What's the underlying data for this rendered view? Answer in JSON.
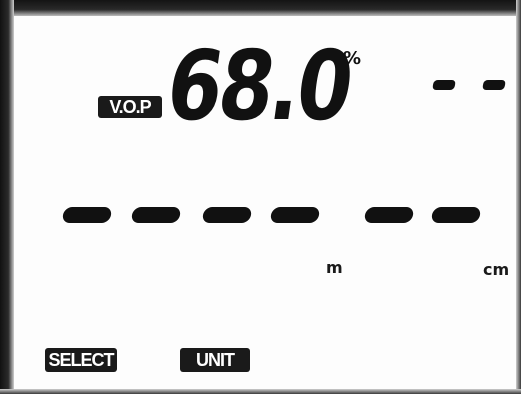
{
  "display": {
    "mode_label": "V.O.P",
    "reading": "68.0",
    "reading_unit": "%",
    "secondary_reading": "- -",
    "length_reading": "------",
    "length_unit_m": "m",
    "length_unit_cm": "cm"
  },
  "buttons": {
    "select": "SELECT",
    "unit": "UNIT"
  },
  "colors": {
    "segment": "#111111",
    "background": "#fdfdfd",
    "bezel": "#1a1a1a"
  }
}
